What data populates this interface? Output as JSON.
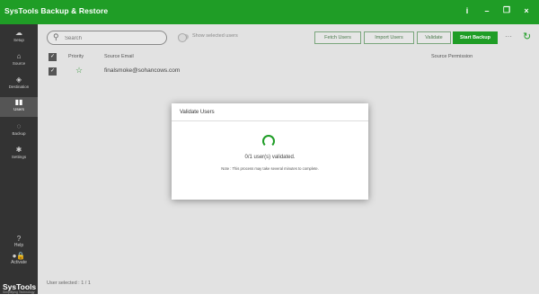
{
  "titlebar": {
    "title": "SysTools Backup & Restore",
    "buttons": [
      "i",
      "–",
      "❐",
      "×"
    ]
  },
  "sidebar": {
    "items": [
      {
        "label": "Setup",
        "icon": "cloud-icon"
      },
      {
        "label": "Source",
        "icon": "home-icon"
      },
      {
        "label": "Destination",
        "icon": "target-icon"
      },
      {
        "label": "Users",
        "icon": "users-icon"
      },
      {
        "label": "Backup",
        "icon": "backup-icon"
      },
      {
        "label": "Settings",
        "icon": "gear-icon"
      }
    ],
    "help_label": "Help",
    "activate_label": "Activate",
    "logo": "SysTools",
    "logo_tagline": "Simplifying Technology"
  },
  "toolbar": {
    "search_placeholder": "Search",
    "toggle_label": "Show selected users",
    "fetch_users": "Fetch Users",
    "import_users": "Import Users",
    "validate": "Validate",
    "start_backup": "Start Backup",
    "more": "···"
  },
  "table": {
    "headers": {
      "priority": "Priority",
      "source_email": "Source Email",
      "source_permission": "Source Permission"
    },
    "rows": [
      {
        "email": "finalsmoke@sohancows.com",
        "checked": true,
        "starred": false
      }
    ]
  },
  "status": {
    "text": "User selected : 1 / 1"
  },
  "modal": {
    "title": "Validate Users",
    "progress_text": "0/1 user(s) validated.",
    "note": "Note : This process may take several minutes to complete."
  },
  "colors": {
    "brand": "#1f9d26",
    "sidebar": "#333333",
    "main_bg": "#e2e2e2"
  }
}
